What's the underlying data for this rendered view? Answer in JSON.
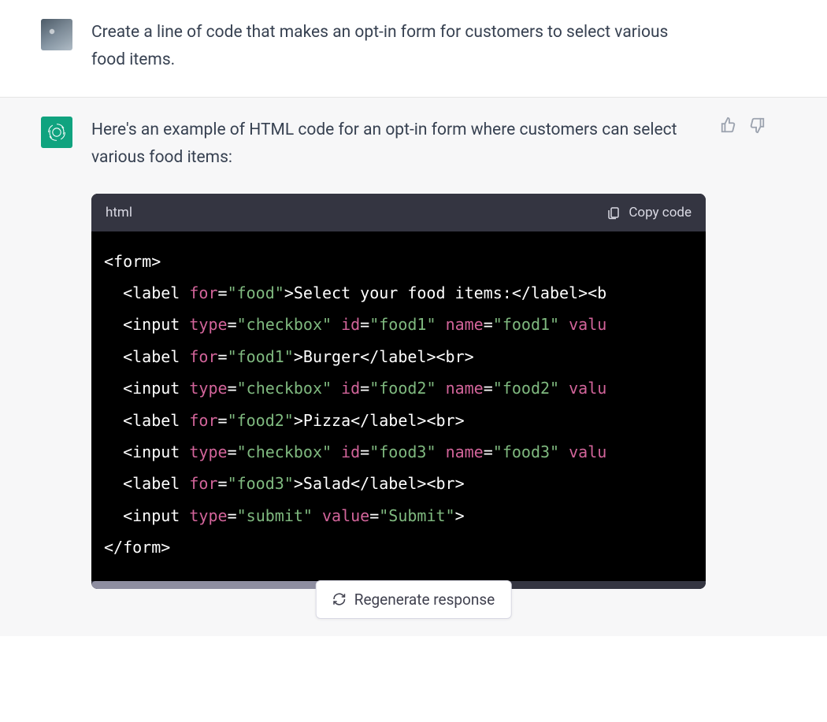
{
  "user": {
    "prompt": "Create a line of code that makes an opt-in form for customers to select various food items."
  },
  "assistant": {
    "intro": "Here's an example of HTML code for an opt-in form where customers can select various food items:",
    "code_lang": "html",
    "copy_label": "Copy code",
    "code": {
      "lines": [
        {
          "indent": 0,
          "tokens": [
            {
              "t": "tag",
              "v": "<form>"
            }
          ]
        },
        {
          "indent": 1,
          "tokens": [
            {
              "t": "tag",
              "v": "<label "
            },
            {
              "t": "attr",
              "v": "for"
            },
            {
              "t": "attrEq",
              "v": "="
            },
            {
              "t": "val",
              "v": "\"food\""
            },
            {
              "t": "tag",
              "v": ">"
            },
            {
              "t": "txt",
              "v": "Select your food items:"
            },
            {
              "t": "tag",
              "v": "</label><b"
            }
          ]
        },
        {
          "indent": 1,
          "tokens": [
            {
              "t": "tag",
              "v": "<input "
            },
            {
              "t": "attr",
              "v": "type"
            },
            {
              "t": "attrEq",
              "v": "="
            },
            {
              "t": "val",
              "v": "\"checkbox\""
            },
            {
              "t": "tag",
              "v": " "
            },
            {
              "t": "attr",
              "v": "id"
            },
            {
              "t": "attrEq",
              "v": "="
            },
            {
              "t": "val",
              "v": "\"food1\""
            },
            {
              "t": "tag",
              "v": " "
            },
            {
              "t": "attr",
              "v": "name"
            },
            {
              "t": "attrEq",
              "v": "="
            },
            {
              "t": "val",
              "v": "\"food1\""
            },
            {
              "t": "tag",
              "v": " "
            },
            {
              "t": "attr",
              "v": "valu"
            }
          ]
        },
        {
          "indent": 1,
          "tokens": [
            {
              "t": "tag",
              "v": "<label "
            },
            {
              "t": "attr",
              "v": "for"
            },
            {
              "t": "attrEq",
              "v": "="
            },
            {
              "t": "val",
              "v": "\"food1\""
            },
            {
              "t": "tag",
              "v": ">"
            },
            {
              "t": "txt",
              "v": "Burger"
            },
            {
              "t": "tag",
              "v": "</label><br>"
            }
          ]
        },
        {
          "indent": 1,
          "tokens": [
            {
              "t": "tag",
              "v": "<input "
            },
            {
              "t": "attr",
              "v": "type"
            },
            {
              "t": "attrEq",
              "v": "="
            },
            {
              "t": "val",
              "v": "\"checkbox\""
            },
            {
              "t": "tag",
              "v": " "
            },
            {
              "t": "attr",
              "v": "id"
            },
            {
              "t": "attrEq",
              "v": "="
            },
            {
              "t": "val",
              "v": "\"food2\""
            },
            {
              "t": "tag",
              "v": " "
            },
            {
              "t": "attr",
              "v": "name"
            },
            {
              "t": "attrEq",
              "v": "="
            },
            {
              "t": "val",
              "v": "\"food2\""
            },
            {
              "t": "tag",
              "v": " "
            },
            {
              "t": "attr",
              "v": "valu"
            }
          ]
        },
        {
          "indent": 1,
          "tokens": [
            {
              "t": "tag",
              "v": "<label "
            },
            {
              "t": "attr",
              "v": "for"
            },
            {
              "t": "attrEq",
              "v": "="
            },
            {
              "t": "val",
              "v": "\"food2\""
            },
            {
              "t": "tag",
              "v": ">"
            },
            {
              "t": "txt",
              "v": "Pizza"
            },
            {
              "t": "tag",
              "v": "</label><br>"
            }
          ]
        },
        {
          "indent": 1,
          "tokens": [
            {
              "t": "tag",
              "v": "<input "
            },
            {
              "t": "attr",
              "v": "type"
            },
            {
              "t": "attrEq",
              "v": "="
            },
            {
              "t": "val",
              "v": "\"checkbox\""
            },
            {
              "t": "tag",
              "v": " "
            },
            {
              "t": "attr",
              "v": "id"
            },
            {
              "t": "attrEq",
              "v": "="
            },
            {
              "t": "val",
              "v": "\"food3\""
            },
            {
              "t": "tag",
              "v": " "
            },
            {
              "t": "attr",
              "v": "name"
            },
            {
              "t": "attrEq",
              "v": "="
            },
            {
              "t": "val",
              "v": "\"food3\""
            },
            {
              "t": "tag",
              "v": " "
            },
            {
              "t": "attr",
              "v": "valu"
            }
          ]
        },
        {
          "indent": 1,
          "tokens": [
            {
              "t": "tag",
              "v": "<label "
            },
            {
              "t": "attr",
              "v": "for"
            },
            {
              "t": "attrEq",
              "v": "="
            },
            {
              "t": "val",
              "v": "\"food3\""
            },
            {
              "t": "tag",
              "v": ">"
            },
            {
              "t": "txt",
              "v": "Salad"
            },
            {
              "t": "tag",
              "v": "</label><br>"
            }
          ]
        },
        {
          "indent": 1,
          "tokens": [
            {
              "t": "tag",
              "v": "<input "
            },
            {
              "t": "attr",
              "v": "type"
            },
            {
              "t": "attrEq",
              "v": "="
            },
            {
              "t": "val",
              "v": "\"submit\""
            },
            {
              "t": "tag",
              "v": " "
            },
            {
              "t": "attr",
              "v": "value"
            },
            {
              "t": "attrEq",
              "v": "="
            },
            {
              "t": "val",
              "v": "\"Submit\""
            },
            {
              "t": "tag",
              "v": ">"
            }
          ]
        },
        {
          "indent": 0,
          "tokens": [
            {
              "t": "tag",
              "v": "</form>"
            }
          ]
        }
      ]
    }
  },
  "controls": {
    "regenerate_label": "Regenerate response"
  }
}
